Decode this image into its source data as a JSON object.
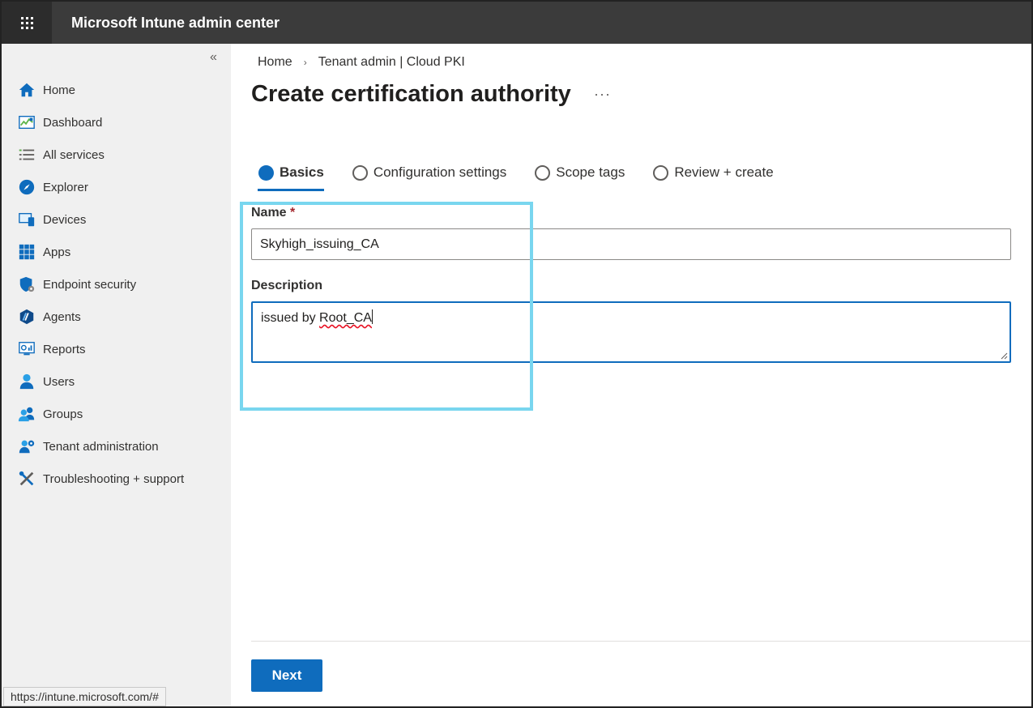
{
  "header": {
    "app_title": "Microsoft Intune admin center"
  },
  "sidebar": {
    "collapse_glyph": "«",
    "items": [
      {
        "label": "Home",
        "icon": "home-icon"
      },
      {
        "label": "Dashboard",
        "icon": "dashboard-icon"
      },
      {
        "label": "All services",
        "icon": "list-icon"
      },
      {
        "label": "Explorer",
        "icon": "explorer-icon"
      },
      {
        "label": "Devices",
        "icon": "devices-icon"
      },
      {
        "label": "Apps",
        "icon": "apps-icon"
      },
      {
        "label": "Endpoint security",
        "icon": "shield-icon"
      },
      {
        "label": "Agents",
        "icon": "agents-icon"
      },
      {
        "label": "Reports",
        "icon": "reports-icon"
      },
      {
        "label": "Users",
        "icon": "user-icon"
      },
      {
        "label": "Groups",
        "icon": "groups-icon"
      },
      {
        "label": "Tenant administration",
        "icon": "tenant-admin-icon"
      },
      {
        "label": "Troubleshooting + support",
        "icon": "tools-icon"
      }
    ]
  },
  "status_bar": {
    "url": "https://intune.microsoft.com/#"
  },
  "breadcrumb": {
    "home": "Home",
    "separator": "›",
    "current": "Tenant admin | Cloud PKI"
  },
  "page": {
    "title": "Create certification authority",
    "more": "···"
  },
  "steps": [
    {
      "label": "Basics",
      "active": true
    },
    {
      "label": "Configuration settings",
      "active": false
    },
    {
      "label": "Scope tags",
      "active": false
    },
    {
      "label": "Review + create",
      "active": false
    }
  ],
  "form": {
    "name_label": "Name",
    "required_marker": "*",
    "name_value": "Skyhigh_issuing_CA",
    "description_label": "Description",
    "description_prefix": "issued by ",
    "description_flagged": "Root_CA"
  },
  "footer": {
    "next_label": "Next"
  },
  "colors": {
    "accent": "#0f6cbd",
    "highlight": "#79d6ef",
    "topbar": "#3b3b3b",
    "sidebar": "#f0f0f0"
  }
}
